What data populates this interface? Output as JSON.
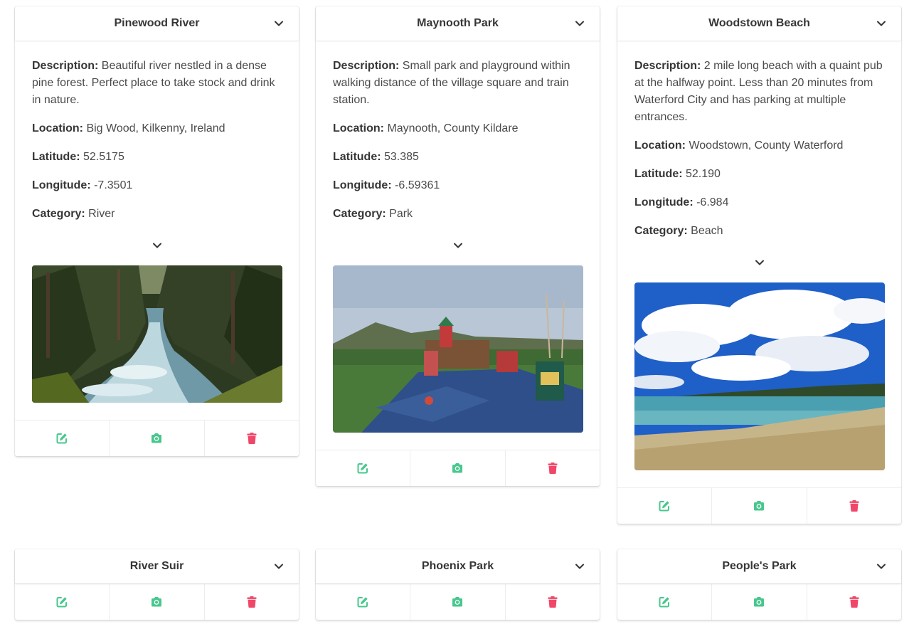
{
  "colors": {
    "edit": "#48c78e",
    "camera": "#48c78e",
    "delete": "#f14668"
  },
  "labels": {
    "description": "Description:",
    "location": "Location:",
    "latitude": "Latitude:",
    "longitude": "Longitude:",
    "category": "Category:"
  },
  "cards": [
    {
      "title": "Pinewood River",
      "description": "Beautiful river nestled in a dense pine forest. Perfect place to take stock and drink in nature.",
      "location": "Big Wood, Kilkenny, Ireland",
      "latitude": "52.5175",
      "longitude": "-7.3501",
      "category": "River"
    },
    {
      "title": "Maynooth Park",
      "description": "Small park and playground within walking distance of the village square and train station.",
      "location": "Maynooth, County Kildare",
      "latitude": "53.385",
      "longitude": "-6.59361",
      "category": "Park"
    },
    {
      "title": "Woodstown Beach",
      "description": "2 mile long beach with a quaint pub at the halfway point. Less than 20 minutes from Waterford City and has parking at multiple entrances.",
      "location": "Woodstown, County Waterford",
      "latitude": "52.190",
      "longitude": "-6.984",
      "category": "Beach"
    },
    {
      "title": "River Suir"
    },
    {
      "title": "Phoenix Park"
    },
    {
      "title": "People's Park"
    }
  ]
}
